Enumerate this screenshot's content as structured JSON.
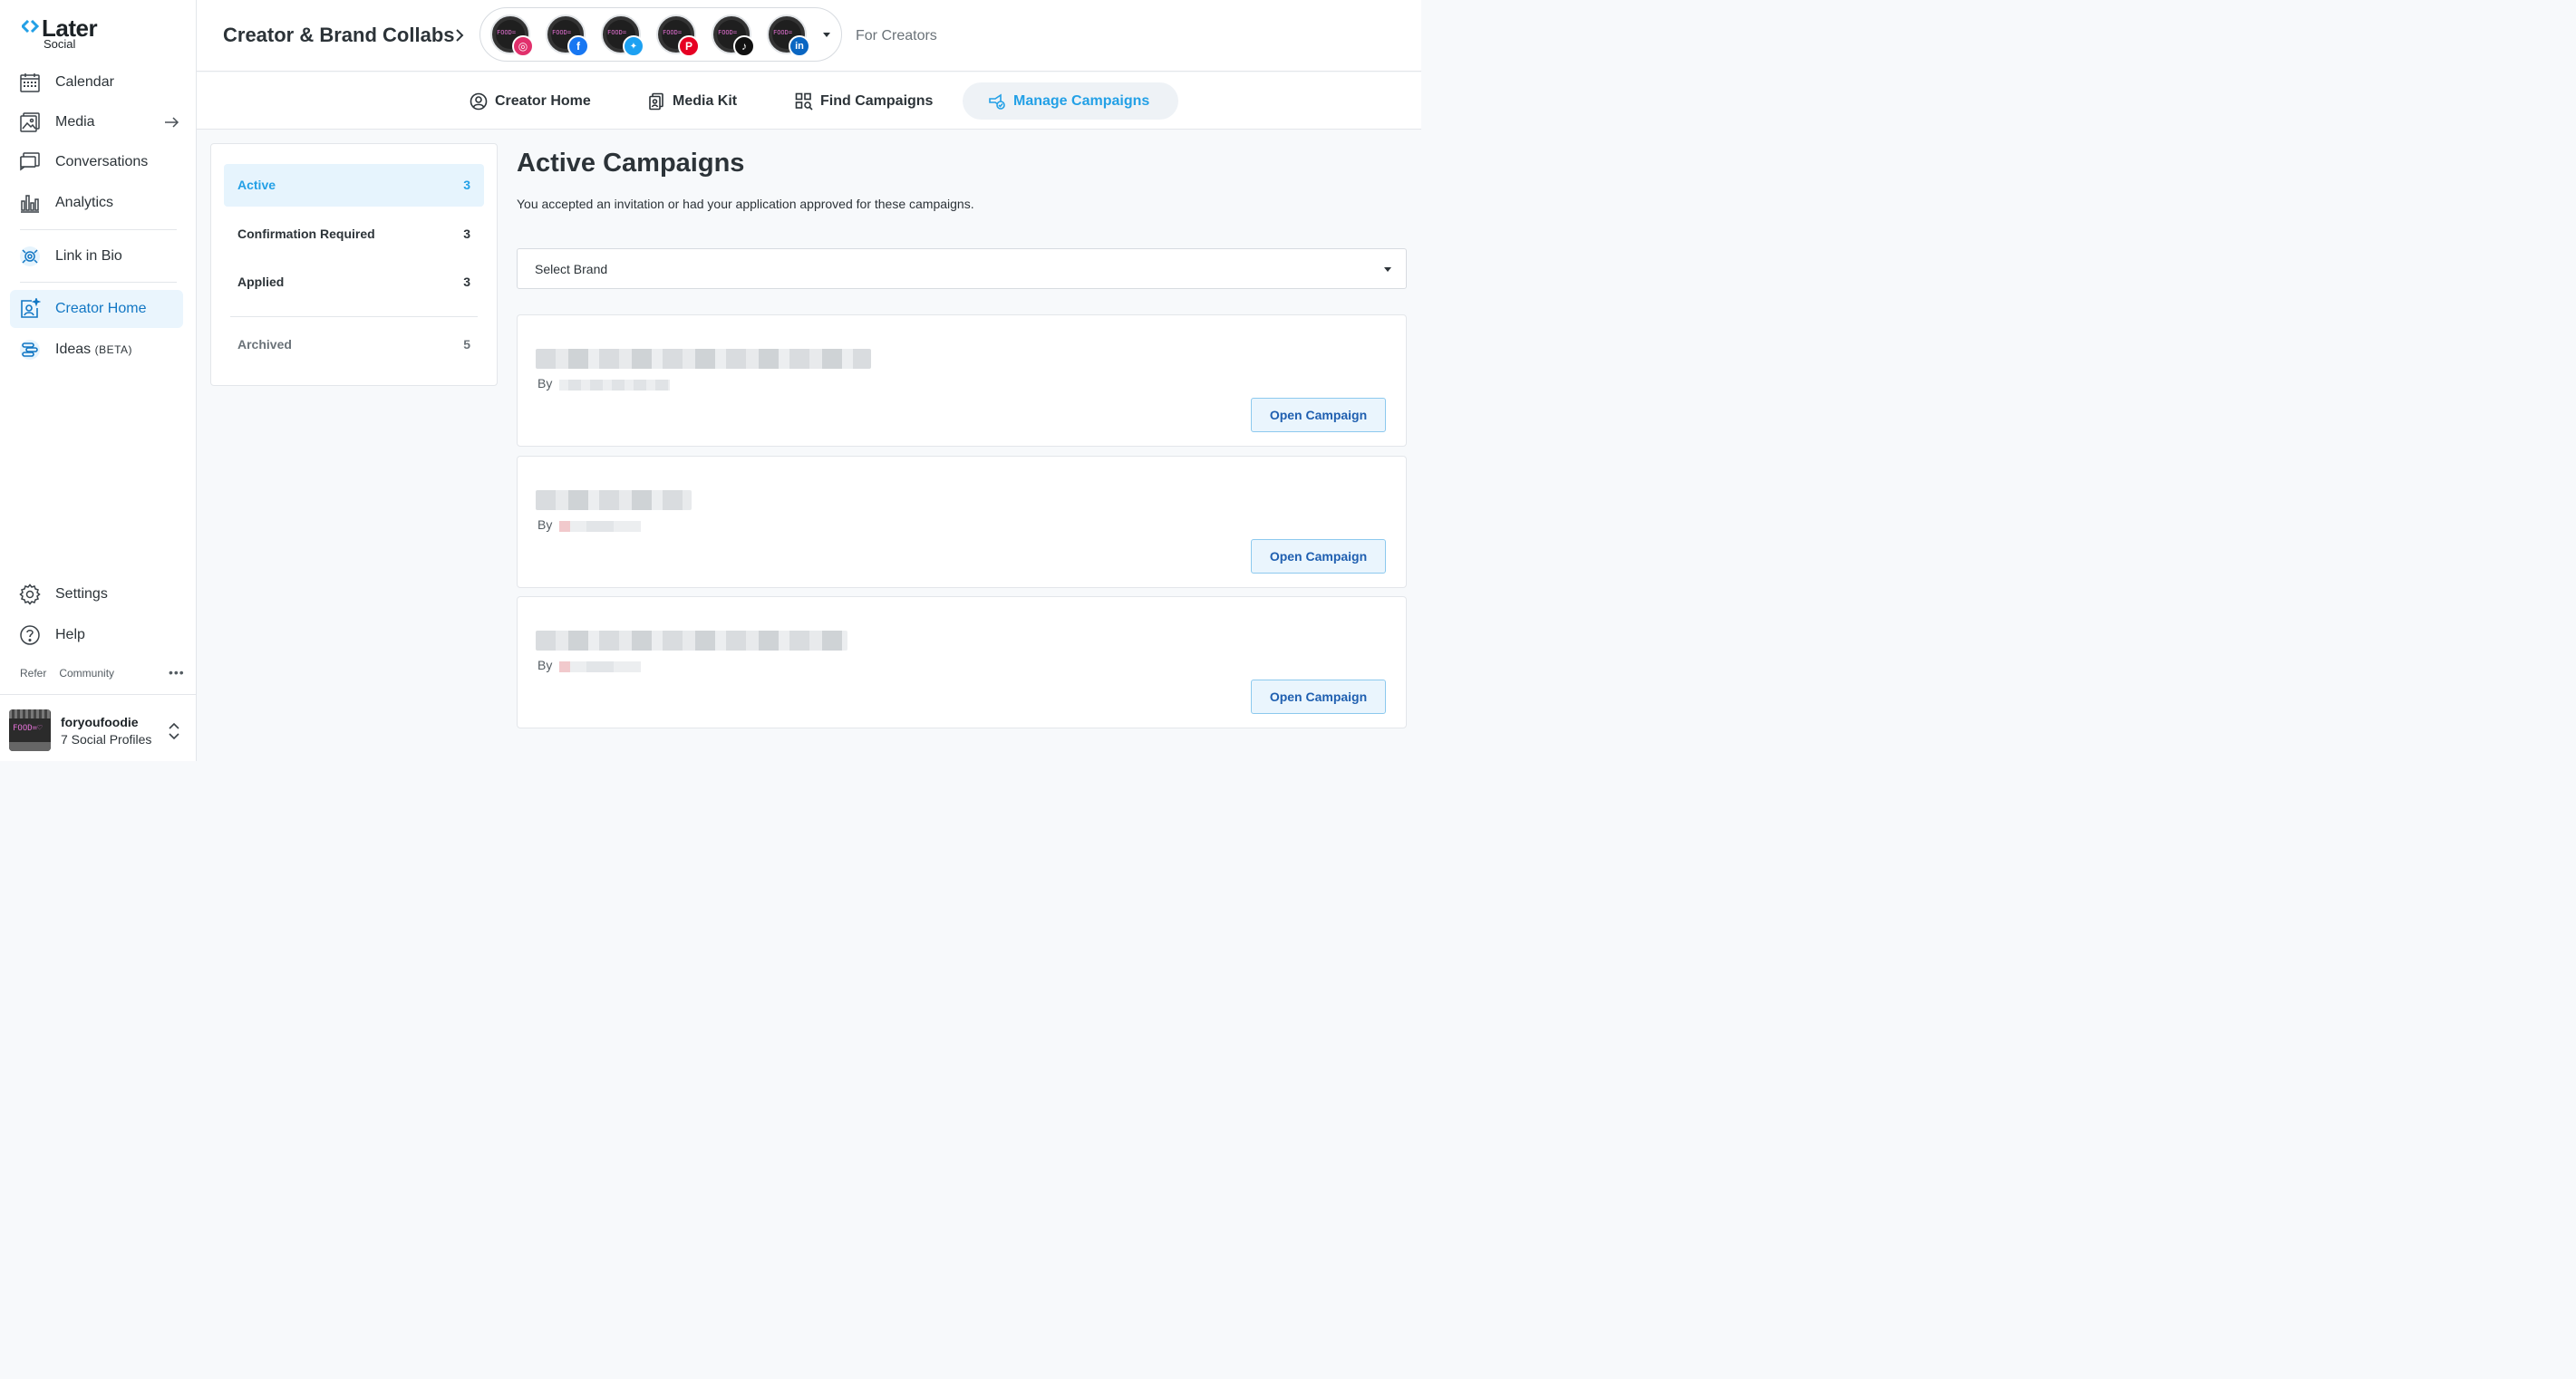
{
  "brand": {
    "name": "Later",
    "subtitle": "Social"
  },
  "sidebar": {
    "items": [
      {
        "label": "Calendar",
        "icon": "calendar-icon"
      },
      {
        "label": "Media",
        "icon": "media-icon"
      },
      {
        "label": "Conversations",
        "icon": "conversations-icon"
      },
      {
        "label": "Analytics",
        "icon": "analytics-icon"
      },
      {
        "label": "Link in Bio",
        "icon": "link-in-bio-icon"
      },
      {
        "label": "Creator Home",
        "icon": "creator-home-icon",
        "active": true
      },
      {
        "label": "Ideas",
        "badge": "(BETA)",
        "icon": "ideas-icon"
      }
    ],
    "bottom_items": [
      {
        "label": "Settings",
        "icon": "gear-icon"
      },
      {
        "label": "Help",
        "icon": "help-icon"
      }
    ],
    "footer_links": [
      "Refer",
      "Community"
    ],
    "profile": {
      "name": "foryoufoodie",
      "subtitle": "7 Social Profiles",
      "avatar_text": "FOOD=♡"
    }
  },
  "header": {
    "title": "Creator & Brand Collabs",
    "avatar_text": "FOOD=",
    "profiles": [
      {
        "network": "instagram",
        "color": "#e1306c",
        "glyph": "◎"
      },
      {
        "network": "facebook",
        "color": "#1877f2",
        "glyph": "f"
      },
      {
        "network": "twitter",
        "color": "#1da1f2",
        "glyph": "🐦"
      },
      {
        "network": "pinterest",
        "color": "#e60023",
        "glyph": "P"
      },
      {
        "network": "tiktok",
        "color": "#111111",
        "glyph": "♪"
      },
      {
        "network": "linkedin",
        "color": "#0a66c2",
        "glyph": "in"
      }
    ],
    "for_creators": "For Creators"
  },
  "tabs": [
    {
      "label": "Creator Home",
      "icon": "creator-home-tab-icon"
    },
    {
      "label": "Media Kit",
      "icon": "media-kit-icon"
    },
    {
      "label": "Find Campaigns",
      "icon": "find-campaigns-icon"
    },
    {
      "label": "Manage Campaigns",
      "icon": "manage-campaigns-icon",
      "active": true
    }
  ],
  "filters": [
    {
      "label": "Active",
      "count": "3"
    },
    {
      "label": "Confirmation Required",
      "count": "3"
    },
    {
      "label": "Applied",
      "count": "3"
    },
    {
      "label": "Archived",
      "count": "5"
    }
  ],
  "main": {
    "title": "Active Campaigns",
    "description": "You accepted an invitation or had your application approved for these campaigns.",
    "select_placeholder": "Select Brand",
    "campaigns": [
      {
        "by_label": "By",
        "button": "Open Campaign"
      },
      {
        "by_label": "By",
        "button": "Open Campaign"
      },
      {
        "by_label": "By",
        "button": "Open Campaign"
      }
    ]
  },
  "colors": {
    "accent": "#23a0e6",
    "button_text": "#1f5fb0",
    "active_bg": "#eaf5fd"
  }
}
